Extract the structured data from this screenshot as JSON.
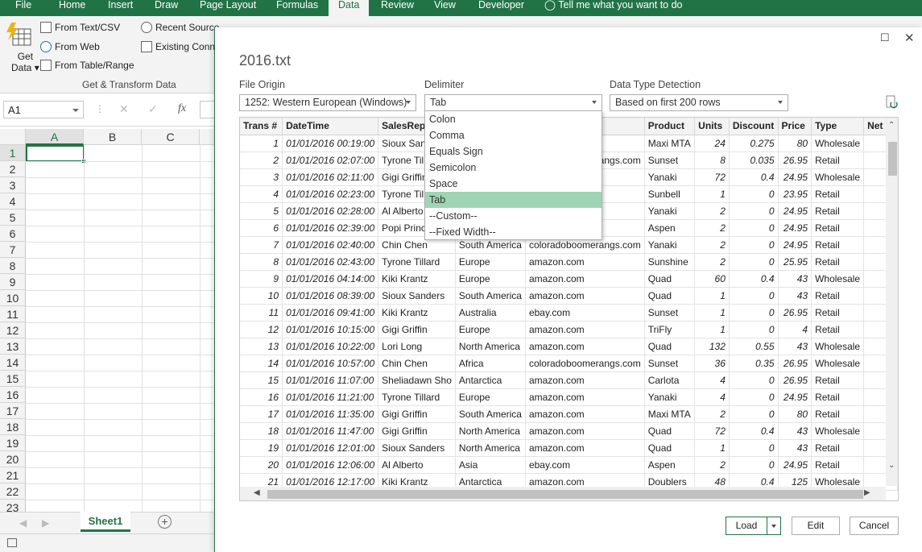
{
  "ribbon": {
    "tabs": [
      "File",
      "Home",
      "Insert",
      "Draw",
      "Page Layout",
      "Formulas",
      "Data",
      "Review",
      "View",
      "Developer"
    ],
    "active_tab": "Data",
    "tell_me": "Tell me what you want to do",
    "get_data_line1": "Get",
    "get_data_line2": "Data",
    "from_text_csv": "From Text/CSV",
    "from_web": "From Web",
    "from_table_range": "From Table/Range",
    "recent_sources": "Recent Source",
    "existing_connections": "Existing Conn",
    "group_label": "Get & Transform Data"
  },
  "formula_bar": {
    "name_box": "A1",
    "fx": "fx"
  },
  "grid": {
    "columns": [
      "A",
      "B",
      "C"
    ],
    "rows": [
      "1",
      "2",
      "3",
      "4",
      "5",
      "6",
      "7",
      "8",
      "9",
      "10",
      "11",
      "12",
      "13",
      "14",
      "15",
      "16",
      "17",
      "18",
      "19",
      "20",
      "21",
      "22",
      "23"
    ]
  },
  "sheet": {
    "tab": "Sheet1",
    "add": "+"
  },
  "dialog": {
    "title": "2016.txt",
    "file_origin_label": "File Origin",
    "file_origin_value": "1252: Western European (Windows)",
    "delimiter_label": "Delimiter",
    "delimiter_value": "Tab",
    "detection_label": "Data Type Detection",
    "detection_value": "Based on first 200 rows",
    "delimiter_options": [
      "Colon",
      "Comma",
      "Equals Sign",
      "Semicolon",
      "Space",
      "Tab",
      "--Custom--",
      "--Fixed Width--"
    ],
    "selected_option": "Tab",
    "load_label": "Load",
    "edit_label": "Edit",
    "cancel_label": "Cancel"
  },
  "table": {
    "headers": [
      "Trans #",
      "DateTime",
      "SalesRep",
      "Region",
      "Website",
      "Product",
      "Units",
      "Discount",
      "Price",
      "Type",
      "Net R"
    ],
    "rows": [
      [
        "1",
        "01/01/2016 00:19:00",
        "Sioux Sand",
        "",
        "",
        "Maxi MTA",
        "24",
        "0.275",
        "80",
        "Wholesale"
      ],
      [
        "2",
        "01/01/2016 02:07:00",
        "Tyrone Till",
        "",
        "coloradoboomerangs.com",
        "Sunset",
        "8",
        "0.035",
        "26.95",
        "Retail"
      ],
      [
        "3",
        "01/01/2016 02:11:00",
        "Gigi Griffin",
        "",
        "",
        "Yanaki",
        "72",
        "0.4",
        "24.95",
        "Wholesale"
      ],
      [
        "4",
        "01/01/2016 02:23:00",
        "Tyrone Till",
        "",
        "",
        "Sunbell",
        "1",
        "0",
        "23.95",
        "Retail"
      ],
      [
        "5",
        "01/01/2016 02:28:00",
        "Al Alberto",
        "",
        "",
        "Yanaki",
        "2",
        "0",
        "24.95",
        "Retail"
      ],
      [
        "6",
        "01/01/2016 02:39:00",
        "Popi Prince",
        "",
        "",
        "Aspen",
        "2",
        "0",
        "24.95",
        "Retail"
      ],
      [
        "7",
        "01/01/2016 02:40:00",
        "Chin Chen",
        "South America",
        "coloradoboomerangs.com",
        "Yanaki",
        "2",
        "0",
        "24.95",
        "Retail"
      ],
      [
        "8",
        "01/01/2016 02:43:00",
        "Tyrone Tillard",
        "Europe",
        "amazon.com",
        "Sunshine",
        "2",
        "0",
        "25.95",
        "Retail"
      ],
      [
        "9",
        "01/01/2016 04:14:00",
        "Kiki Krantz",
        "Europe",
        "amazon.com",
        "Quad",
        "60",
        "0.4",
        "43",
        "Wholesale"
      ],
      [
        "10",
        "01/01/2016 08:39:00",
        "Sioux Sanders",
        "South America",
        "amazon.com",
        "Quad",
        "1",
        "0",
        "43",
        "Retail"
      ],
      [
        "11",
        "01/01/2016 09:41:00",
        "Kiki Krantz",
        "Australia",
        "ebay.com",
        "Sunset",
        "1",
        "0",
        "26.95",
        "Retail"
      ],
      [
        "12",
        "01/01/2016 10:15:00",
        "Gigi Griffin",
        "Europe",
        "amazon.com",
        "TriFly",
        "1",
        "0",
        "4",
        "Retail"
      ],
      [
        "13",
        "01/01/2016 10:22:00",
        "Lori Long",
        "North America",
        "amazon.com",
        "Quad",
        "132",
        "0.55",
        "43",
        "Wholesale"
      ],
      [
        "14",
        "01/01/2016 10:57:00",
        "Chin Chen",
        "Africa",
        "coloradoboomerangs.com",
        "Sunset",
        "36",
        "0.35",
        "26.95",
        "Wholesale"
      ],
      [
        "15",
        "01/01/2016 11:07:00",
        "Sheliadawn Sho",
        "Antarctica",
        "amazon.com",
        "Carlota",
        "4",
        "0",
        "26.95",
        "Retail"
      ],
      [
        "16",
        "01/01/2016 11:21:00",
        "Tyrone Tillard",
        "Europe",
        "amazon.com",
        "Yanaki",
        "4",
        "0",
        "24.95",
        "Retail"
      ],
      [
        "17",
        "01/01/2016 11:35:00",
        "Gigi Griffin",
        "South America",
        "amazon.com",
        "Maxi MTA",
        "2",
        "0",
        "80",
        "Retail"
      ],
      [
        "18",
        "01/01/2016 11:47:00",
        "Gigi Griffin",
        "North America",
        "amazon.com",
        "Quad",
        "72",
        "0.4",
        "43",
        "Wholesale"
      ],
      [
        "19",
        "01/01/2016 12:01:00",
        "Sioux Sanders",
        "North America",
        "amazon.com",
        "Quad",
        "1",
        "0",
        "43",
        "Retail"
      ],
      [
        "20",
        "01/01/2016 12:06:00",
        "Al Alberto",
        "Asia",
        "ebay.com",
        "Aspen",
        "2",
        "0",
        "24.95",
        "Retail"
      ],
      [
        "21",
        "01/01/2016 12:17:00",
        "Kiki Krantz",
        "Antarctica",
        "amazon.com",
        "Doublers",
        "48",
        "0.4",
        "125",
        "Wholesale"
      ]
    ]
  },
  "colors": {
    "excel_green": "#217346",
    "selected_option": "#9fd5b3"
  }
}
